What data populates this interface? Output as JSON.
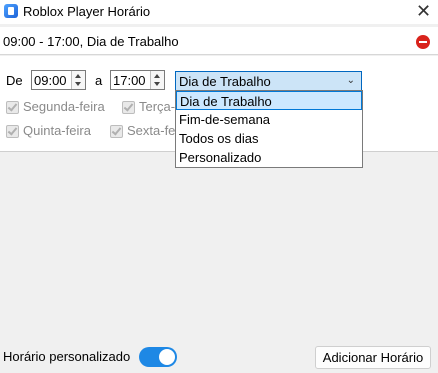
{
  "window": {
    "title": "Roblox Player Horário",
    "close_glyph": "✕"
  },
  "summary": {
    "text": "09:00 - 17:00, Dia de Trabalho"
  },
  "editor": {
    "from_label": "De",
    "start_time": "09:00",
    "to_label": "a",
    "end_time": "17:00",
    "preset_selected": "Dia de Trabalho",
    "days": [
      {
        "label": "Segunda-feira",
        "checked": true
      },
      {
        "label": "Terça-f",
        "checked": true
      },
      {
        "label": "Quinta-feira",
        "checked": true
      },
      {
        "label": "Sexta-fe",
        "checked": true
      }
    ]
  },
  "dropdown": {
    "options": [
      "Dia de Trabalho",
      "Fim-de-semana",
      "Todos os dias",
      "Personalizado"
    ],
    "highlighted_index": 0
  },
  "bottom": {
    "custom_label": "Horário personalizado",
    "toggle_on": true,
    "add_button": "Adicionar Horário"
  },
  "colors": {
    "accent": "#1e88e5",
    "remove_red": "#d9231c",
    "selection": "#cce8ff"
  }
}
